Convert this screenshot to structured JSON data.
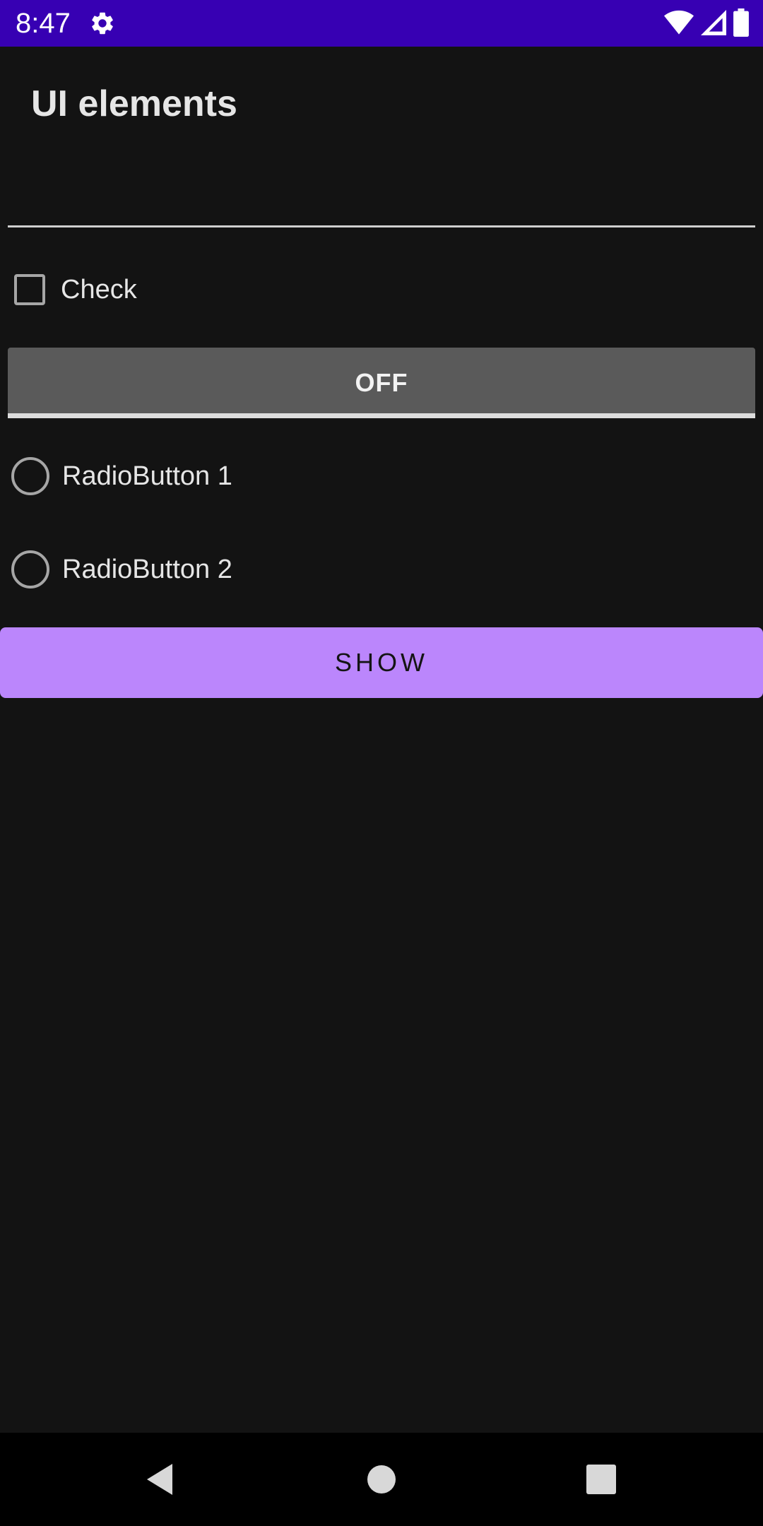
{
  "status_bar": {
    "time": "8:47",
    "icons": [
      "gear-icon",
      "wifi-icon",
      "cell-signal-icon",
      "battery-icon"
    ],
    "background": "#3700B3"
  },
  "app": {
    "title": "UI elements"
  },
  "edit_text": {
    "value": "",
    "placeholder": ""
  },
  "checkbox": {
    "label": "Check",
    "checked": false
  },
  "toggle": {
    "label": "OFF",
    "state": false
  },
  "radios": [
    {
      "label": "RadioButton 1",
      "checked": false
    },
    {
      "label": "RadioButton 2",
      "checked": false
    }
  ],
  "show_button": {
    "label": "SHOW",
    "color": "#BB86FC"
  },
  "nav_bar": {
    "icons": [
      "back-icon",
      "home-icon",
      "recents-icon"
    ]
  },
  "colors": {
    "background": "#131313",
    "accent": "#BB86FC",
    "status_bar": "#3700B3"
  }
}
